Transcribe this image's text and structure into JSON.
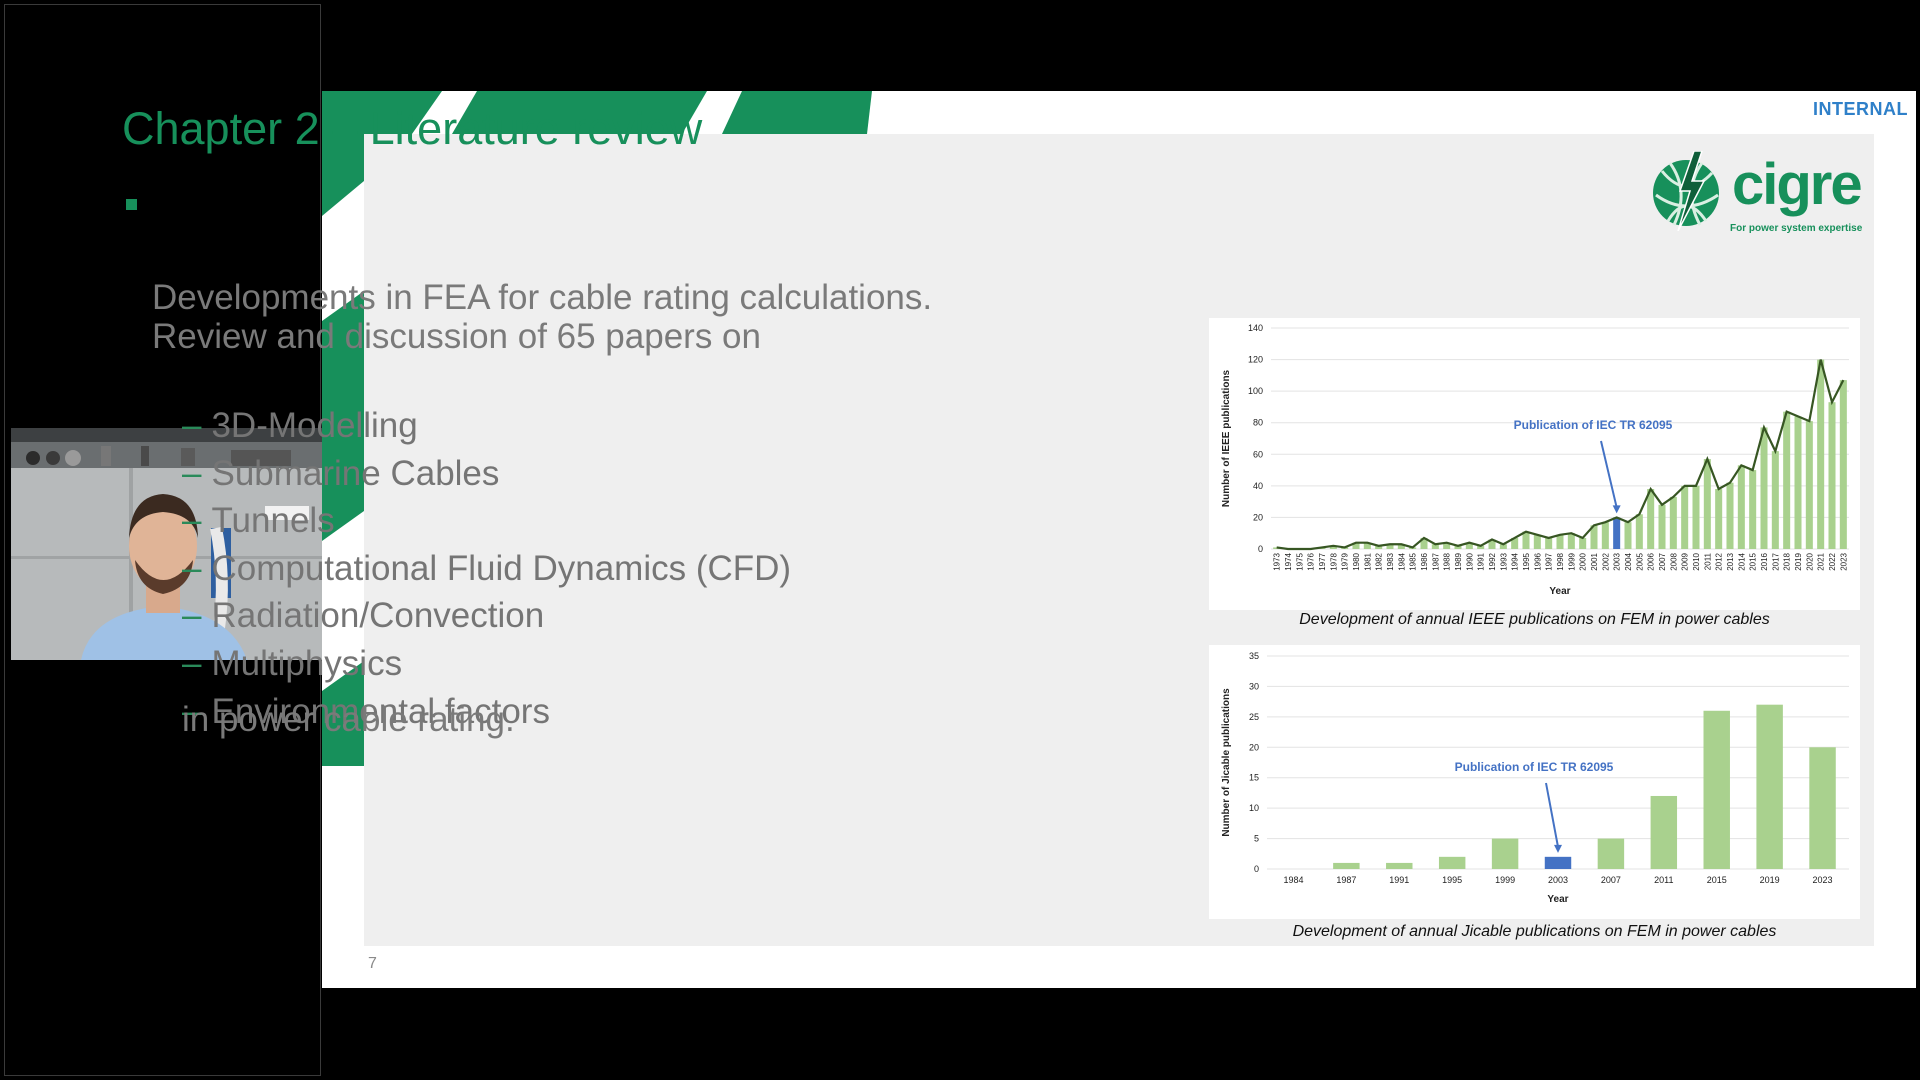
{
  "slide": {
    "classification": "INTERNAL",
    "title": "Chapter 2 – Literature review",
    "intro_line1": "Developments in FEA for cable rating calculations.",
    "intro_line2": "Review and discussion of 65 papers on",
    "topics": [
      "3D-Modelling",
      "Submarine Cables",
      "Tunnels",
      "Computational Fluid Dynamics (CFD)",
      "Radiation/Convection",
      "Multiphysics",
      "Environmental factors"
    ],
    "dash": "–",
    "closing": "in power cable rating.",
    "page_number": "7",
    "logo": {
      "text": "cigre",
      "tagline": "For power system expertise",
      "icon": "cigre-globe-lightning-icon"
    },
    "captions": {
      "ieee": "Development of annual IEEE publications on FEM in power cables",
      "jicable": "Development of annual Jicable publications on FEM in power cables"
    }
  },
  "colors": {
    "brand_green": "#17905b",
    "bar_green": "#a9d18e",
    "highlight_blue": "#4472c4",
    "line_dark": "#375623"
  },
  "chart_data": [
    {
      "type": "bar",
      "ylabel": "Number of IEEE publications",
      "xlabel": "Year",
      "ylim": [
        0,
        140
      ],
      "yticks": [
        0,
        20,
        40,
        60,
        80,
        100,
        120,
        140
      ],
      "grid": true,
      "annotation": "Publication of IEC TR 62095",
      "highlight_category": "2003",
      "overlay_line": true,
      "categories": [
        "1973",
        "1974",
        "1975",
        "1976",
        "1977",
        "1978",
        "1979",
        "1980",
        "1981",
        "1982",
        "1983",
        "1984",
        "1985",
        "1986",
        "1987",
        "1988",
        "1989",
        "1990",
        "1991",
        "1992",
        "1993",
        "1994",
        "1995",
        "1996",
        "1997",
        "1998",
        "1999",
        "2000",
        "2001",
        "2002",
        "2003",
        "2004",
        "2005",
        "2006",
        "2007",
        "2008",
        "2009",
        "2010",
        "2011",
        "2012",
        "2013",
        "2014",
        "2015",
        "2016",
        "2017",
        "2018",
        "2019",
        "2020",
        "2021",
        "2022",
        "2023"
      ],
      "values": [
        1,
        0,
        0,
        0,
        1,
        2,
        1,
        4,
        4,
        2,
        3,
        3,
        1,
        7,
        3,
        4,
        2,
        4,
        2,
        6,
        3,
        7,
        11,
        9,
        7,
        9,
        10,
        7,
        15,
        17,
        20,
        17,
        22,
        38,
        28,
        33,
        40,
        40,
        57,
        38,
        42,
        53,
        50,
        77,
        62,
        87,
        84,
        81,
        120,
        93,
        107
      ]
    },
    {
      "type": "bar",
      "ylabel": "Number of Jicable publications",
      "xlabel": "Year",
      "ylim": [
        0,
        35
      ],
      "yticks": [
        0,
        5,
        10,
        15,
        20,
        25,
        30,
        35
      ],
      "grid": true,
      "annotation": "Publication of IEC TR 62095",
      "highlight_category": "2003",
      "categories": [
        "1984",
        "1987",
        "1991",
        "1995",
        "1999",
        "2003",
        "2007",
        "2011",
        "2015",
        "2019",
        "2023"
      ],
      "values": [
        0,
        1,
        1,
        2,
        5,
        2,
        5,
        12,
        26,
        27,
        20
      ]
    }
  ]
}
